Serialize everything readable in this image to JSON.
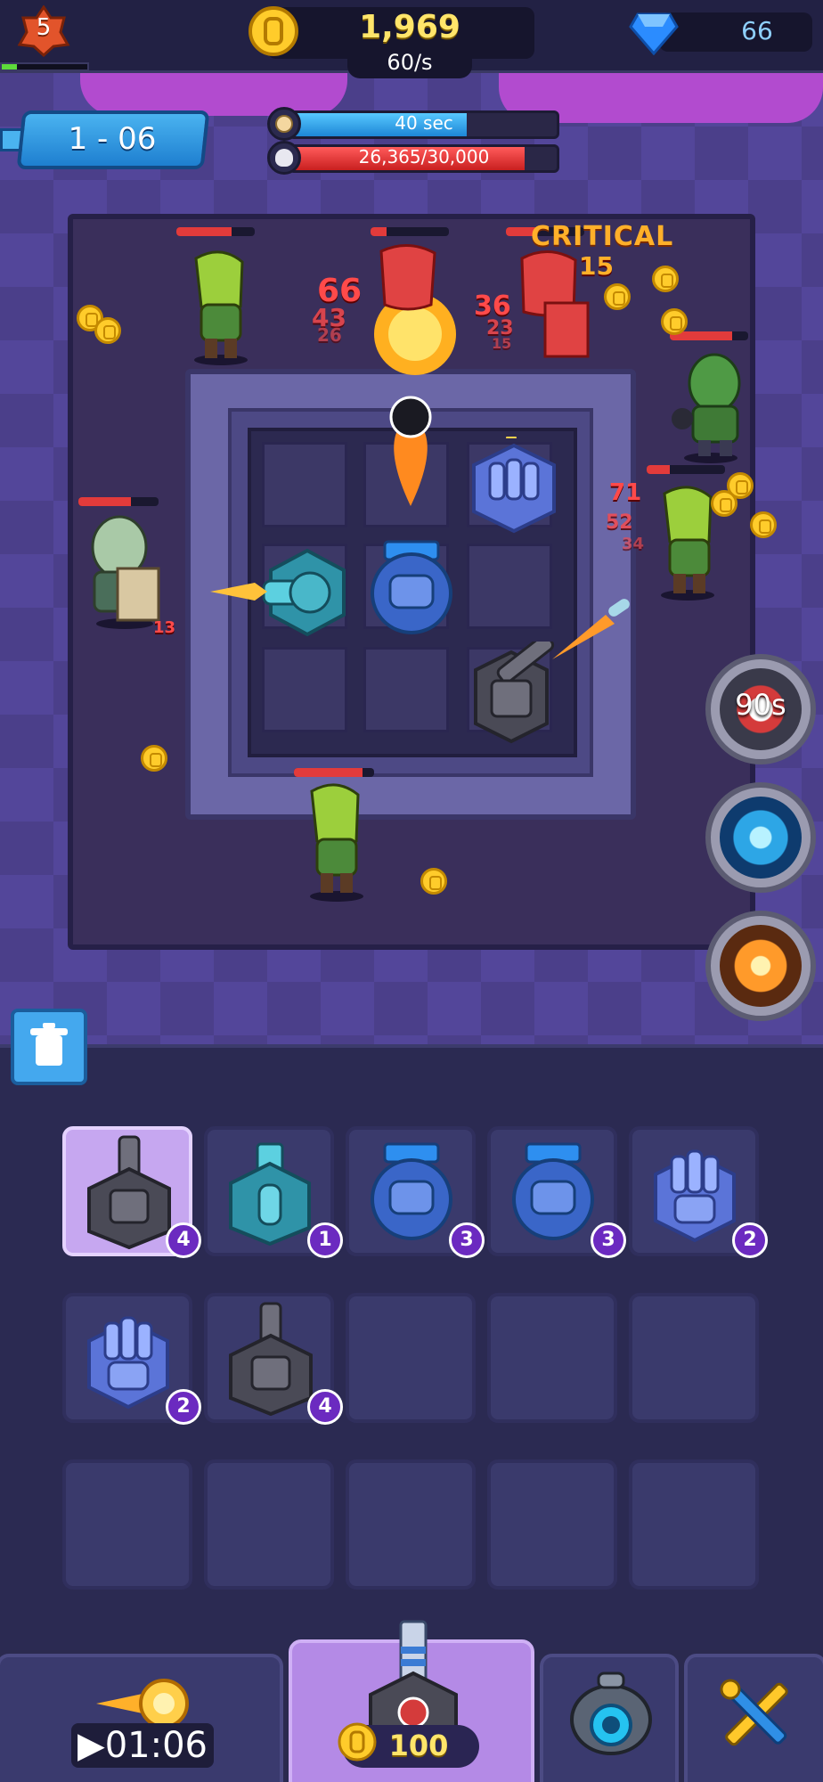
{
  "hud": {
    "player_level": "5",
    "level_progress": 0.18,
    "coins": "1,969",
    "coin_rate": "60/s",
    "gems": "66"
  },
  "stage": {
    "label": "1 - 06",
    "timer_text": "40 sec",
    "timer_fraction": 0.66,
    "boss_hp_text": "26,365/30,000",
    "boss_hp_fraction": 0.88
  },
  "combat_text": {
    "critical": "CRITICAL",
    "critical_value": "15",
    "numbers": [
      "66",
      "43",
      "26",
      "36",
      "23",
      "15",
      "71",
      "52",
      "34",
      "13"
    ]
  },
  "skills": [
    {
      "name": "missile-skill",
      "label": "90s"
    },
    {
      "name": "tornado-skill",
      "label": ""
    },
    {
      "name": "meteor-skill",
      "label": ""
    }
  ],
  "inventory": {
    "row1": [
      {
        "turret": "gray-cannon",
        "level": "4",
        "selected": true
      },
      {
        "turret": "teal-cannon",
        "level": "1"
      },
      {
        "turret": "blue-heavy",
        "level": "3"
      },
      {
        "turret": "blue-heavy",
        "level": "3"
      },
      {
        "turret": "twin-gun",
        "level": "2"
      }
    ],
    "row2": [
      {
        "turret": "twin-gun",
        "level": "2"
      },
      {
        "turret": "gray-cannon",
        "level": "4"
      }
    ]
  },
  "bottom_nav": {
    "speed_boost_time": "▶01:06",
    "buy_turret_cost": "100"
  },
  "colors": {
    "coin_gold": "#ffcc2b",
    "gem_blue": "#8fd0ff",
    "hp_red": "#e23b3b",
    "timer_blue": "#57c8ff",
    "level_purple": "#6b2ac0"
  }
}
